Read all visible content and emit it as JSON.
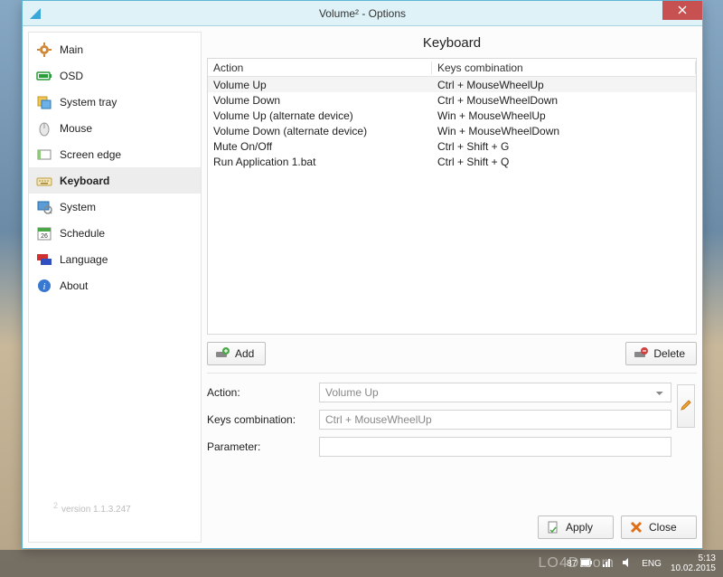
{
  "window": {
    "title": "Volume² - Options",
    "version": "version 1.1.3.247",
    "version_sup": "2"
  },
  "sidebar": {
    "items": [
      {
        "label": "Main",
        "icon": "gear"
      },
      {
        "label": "OSD",
        "icon": "battery"
      },
      {
        "label": "System tray",
        "icon": "tray"
      },
      {
        "label": "Mouse",
        "icon": "mouse"
      },
      {
        "label": "Screen edge",
        "icon": "edge"
      },
      {
        "label": "Keyboard",
        "icon": "keyboard",
        "selected": true
      },
      {
        "label": "System",
        "icon": "system"
      },
      {
        "label": "Schedule",
        "icon": "calendar"
      },
      {
        "label": "Language",
        "icon": "flags"
      },
      {
        "label": "About",
        "icon": "info"
      }
    ]
  },
  "main": {
    "title": "Keyboard",
    "columns": {
      "action": "Action",
      "keys": "Keys combination"
    },
    "rows": [
      {
        "action": "Volume Up",
        "keys": "Ctrl + MouseWheelUp",
        "selected": true
      },
      {
        "action": "Volume Down",
        "keys": "Ctrl + MouseWheelDown"
      },
      {
        "action": "Volume Up (alternate device)",
        "keys": "Win + MouseWheelUp"
      },
      {
        "action": "Volume Down (alternate device)",
        "keys": "Win + MouseWheelDown"
      },
      {
        "action": "Mute On/Off",
        "keys": "Ctrl + Shift + G"
      },
      {
        "action": "Run Application 1.bat",
        "keys": "Ctrl + Shift + Q"
      }
    ],
    "buttons": {
      "add": "Add",
      "delete": "Delete"
    },
    "form": {
      "action_label": "Action:",
      "action_value": "Volume Up",
      "keys_label": "Keys combination:",
      "keys_value": "Ctrl + MouseWheelUp",
      "param_label": "Parameter:",
      "param_value": ""
    },
    "footer": {
      "apply": "Apply",
      "close": "Close"
    }
  },
  "taskbar": {
    "battery": "87",
    "lang": "ENG",
    "time": "5:13",
    "date": "10.02.2015"
  },
  "watermark": "LO4D.com"
}
